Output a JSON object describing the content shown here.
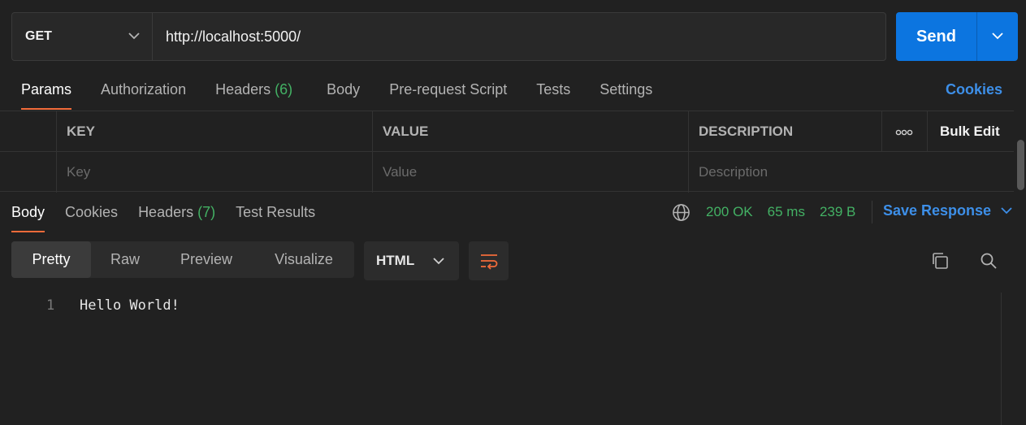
{
  "request": {
    "method": "GET",
    "url": "http://localhost:5000/",
    "send_label": "Send"
  },
  "request_tabs": [
    {
      "label": "Params",
      "active": true
    },
    {
      "label": "Authorization"
    },
    {
      "label": "Headers",
      "count": "(6)"
    },
    {
      "label": "Body"
    },
    {
      "label": "Pre-request Script"
    },
    {
      "label": "Tests"
    },
    {
      "label": "Settings"
    }
  ],
  "cookies_link": "Cookies",
  "params_table": {
    "headers": {
      "key": "KEY",
      "value": "VALUE",
      "description": "DESCRIPTION"
    },
    "more_icon": "ooo",
    "bulk_edit": "Bulk Edit",
    "placeholders": {
      "key": "Key",
      "value": "Value",
      "description": "Description"
    }
  },
  "response_tabs": [
    {
      "label": "Body",
      "active": true
    },
    {
      "label": "Cookies"
    },
    {
      "label": "Headers",
      "count": "(7)"
    },
    {
      "label": "Test Results"
    }
  ],
  "response_status": {
    "status": "200 OK",
    "time": "65 ms",
    "size": "239 B",
    "save_label": "Save Response"
  },
  "view_modes": [
    "Pretty",
    "Raw",
    "Preview",
    "Visualize"
  ],
  "active_view_mode": "Pretty",
  "language": "HTML",
  "body_lines": [
    {
      "num": "1",
      "text": "Hello World!"
    }
  ],
  "icons": {
    "method_dropdown": "chevron-down-icon",
    "send_dropdown": "chevron-down-icon",
    "network": "globe-icon",
    "wrap": "wrap-lines-icon",
    "copy": "copy-icon",
    "search": "search-icon"
  },
  "colors": {
    "accent_blue": "#0c75e0",
    "link_blue": "#3d8fe8",
    "success_green": "#43b164",
    "tab_underline": "#f26b3a",
    "background": "#212121"
  }
}
